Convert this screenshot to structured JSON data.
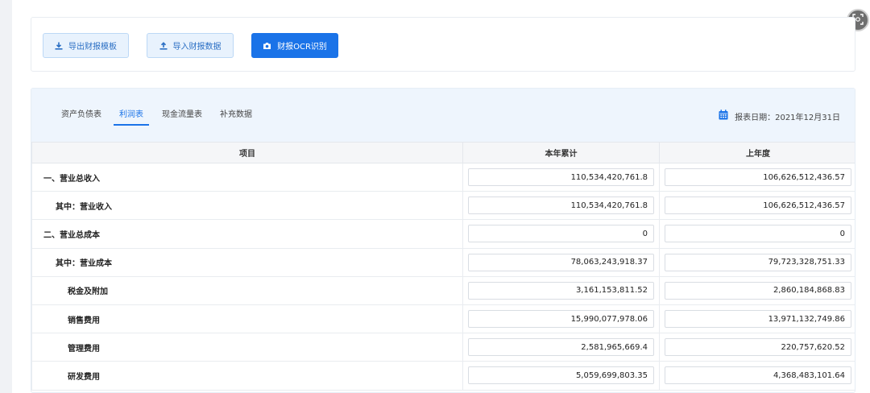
{
  "toolbar": {
    "export_label": "导出财报模板",
    "import_label": "导入财报数据",
    "ocr_label": "财报OCR识别"
  },
  "tabs": [
    {
      "label": "资产负债表",
      "active": false
    },
    {
      "label": "利润表",
      "active": true
    },
    {
      "label": "现金流量表",
      "active": false
    },
    {
      "label": "补充数据",
      "active": false
    }
  ],
  "report_date": {
    "label": "报表日期：",
    "value": "2021年12月31日"
  },
  "table": {
    "headers": [
      "项目",
      "本年累计",
      "上年度"
    ],
    "rows": [
      {
        "item": "一、营业总收入",
        "current": "110,534,420,761.8",
        "previous": "106,626,512,436.57"
      },
      {
        "item": "其中：营业收入",
        "current": "110,534,420,761.8",
        "previous": "106,626,512,436.57"
      },
      {
        "item": "二、营业总成本",
        "current": "0",
        "previous": "0"
      },
      {
        "item": "其中：营业成本",
        "current": "78,063,243,918.37",
        "previous": "79,723,328,751.33"
      },
      {
        "item": "税金及附加",
        "current": "3,161,153,811.52",
        "previous": "2,860,184,868.83"
      },
      {
        "item": "销售费用",
        "current": "15,990,077,978.06",
        "previous": "13,971,132,749.86"
      },
      {
        "item": "管理费用",
        "current": "2,581,965,669.4",
        "previous": "220,757,620.52"
      },
      {
        "item": "研发费用",
        "current": "5,059,699,803.35",
        "previous": "4,368,483,101.64"
      }
    ]
  },
  "colors": {
    "primary": "#1a73e8",
    "tab_bar_bg": "#eef5fd"
  },
  "icons": {
    "export": "download-icon",
    "import": "upload-icon",
    "ocr": "camera-icon",
    "date": "calendar-icon",
    "floating": "scan-icon"
  }
}
